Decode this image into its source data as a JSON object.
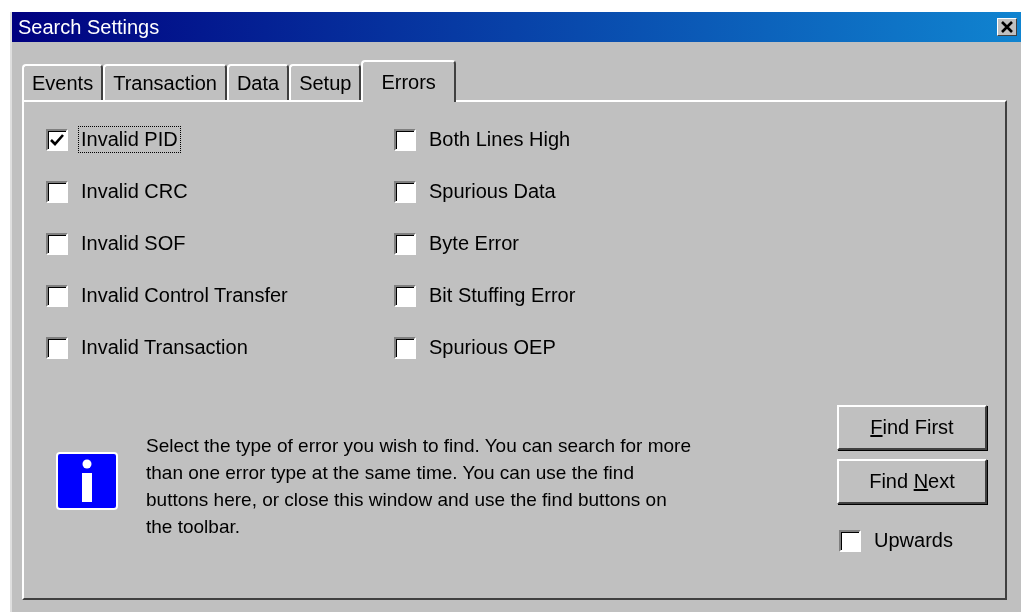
{
  "window": {
    "title": "Search Settings"
  },
  "tabs": [
    {
      "label": "Events",
      "selected": false
    },
    {
      "label": "Transaction",
      "selected": false
    },
    {
      "label": "Data",
      "selected": false
    },
    {
      "label": "Setup",
      "selected": false
    },
    {
      "label": "Errors",
      "selected": true
    }
  ],
  "error_columns": [
    [
      {
        "label": "Invalid PID",
        "checked": true,
        "focused": true
      },
      {
        "label": "Invalid CRC",
        "checked": false,
        "focused": false
      },
      {
        "label": "Invalid SOF",
        "checked": false,
        "focused": false
      },
      {
        "label": "Invalid Control Transfer",
        "checked": false,
        "focused": false
      },
      {
        "label": "Invalid Transaction",
        "checked": false,
        "focused": false
      }
    ],
    [
      {
        "label": "Both Lines High",
        "checked": false,
        "focused": false
      },
      {
        "label": "Spurious Data",
        "checked": false,
        "focused": false
      },
      {
        "label": "Byte Error",
        "checked": false,
        "focused": false
      },
      {
        "label": "Bit Stuffing Error",
        "checked": false,
        "focused": false
      },
      {
        "label": "Spurious OEP",
        "checked": false,
        "focused": false
      }
    ]
  ],
  "info_text": "Select the type of error you wish to find. You can search for more than one error type at the same time. You can use the find buttons here, or close this window and use the find buttons on the toolbar.",
  "buttons": [
    {
      "access_key": "F",
      "after": "ind First"
    },
    {
      "before": "Find ",
      "access_key": "N",
      "after": "ext"
    }
  ],
  "upwards": {
    "label": "Upwards",
    "checked": false
  }
}
